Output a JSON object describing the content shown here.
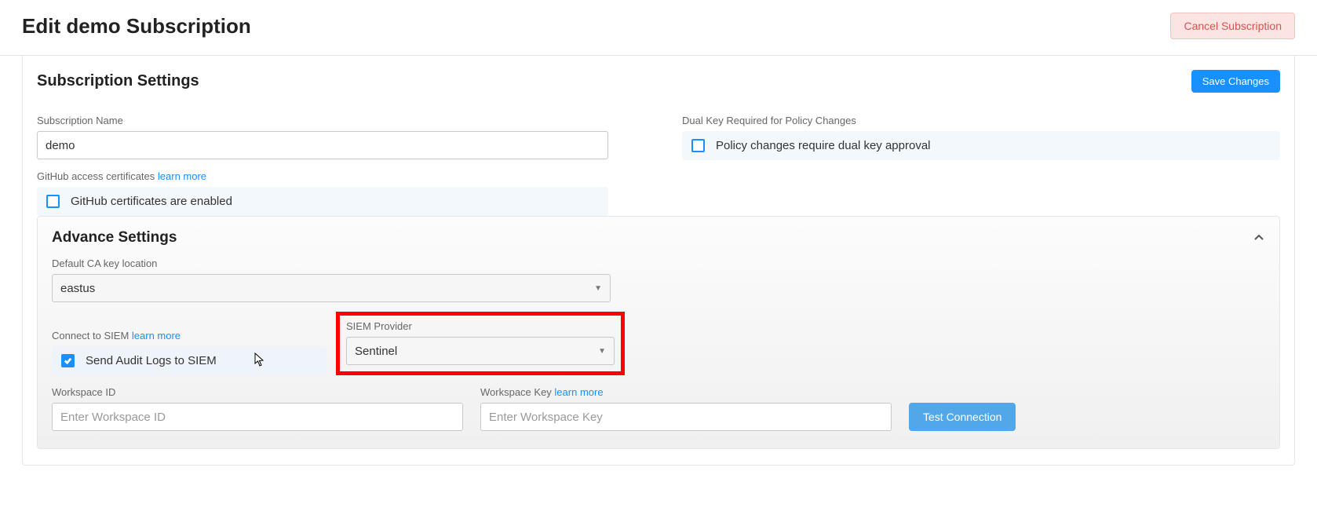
{
  "header": {
    "title": "Edit demo Subscription",
    "cancel_label": "Cancel Subscription"
  },
  "settings": {
    "title": "Subscription Settings",
    "save_label": "Save Changes",
    "subscription_name_label": "Subscription Name",
    "subscription_name_value": "demo",
    "dual_key_label": "Dual Key Required for Policy Changes",
    "dual_key_check_label": "Policy changes require dual key approval",
    "dual_key_checked": false,
    "github_label_prefix": "GitHub access certificates ",
    "github_learn_more": "learn more",
    "github_check_label": "GitHub certificates are enabled",
    "github_checked": false
  },
  "advance": {
    "title": "Advance Settings",
    "expanded": true,
    "ca_label": "Default CA key location",
    "ca_value": "eastus",
    "siem_label_prefix": "Connect to SIEM ",
    "siem_learn_more": "learn more",
    "siem_check_label": "Send Audit Logs to SIEM",
    "siem_checked": true,
    "siem_provider_label": "SIEM Provider",
    "siem_provider_value": "Sentinel",
    "workspace_id_label": "Workspace ID",
    "workspace_id_placeholder": "Enter Workspace ID",
    "workspace_id_value": "",
    "workspace_key_label_prefix": "Workspace Key ",
    "workspace_key_learn_more": "learn more",
    "workspace_key_placeholder": "Enter Workspace Key",
    "workspace_key_value": "",
    "test_conn_label": "Test Connection"
  }
}
